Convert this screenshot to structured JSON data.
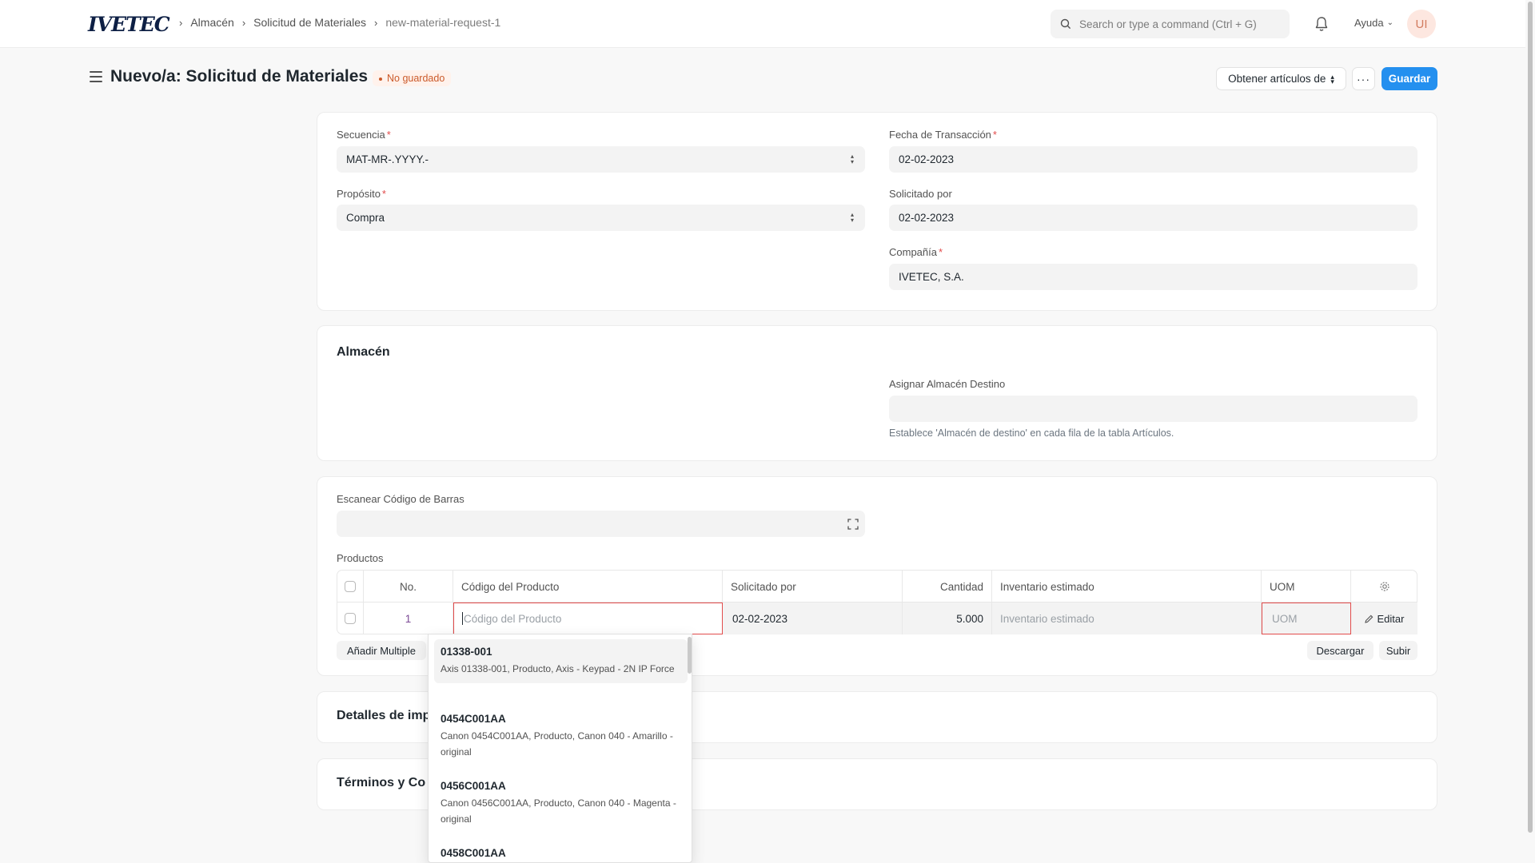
{
  "brand": {
    "logo_text": "IVETEC"
  },
  "breadcrumb": [
    "Almacén",
    "Solicitud de Materiales",
    "new-material-request-1"
  ],
  "search": {
    "placeholder": "Search or type a command (Ctrl + G)"
  },
  "navbar": {
    "help_label": "Ayuda",
    "avatar_initials": "UI"
  },
  "page": {
    "title": "Nuevo/a: Solicitud de Materiales",
    "status": "No guardado",
    "get_items_label": "Obtener artículos de",
    "more_label": "···",
    "save_label": "Guardar"
  },
  "form": {
    "secuencia": {
      "label": "Secuencia",
      "value": "MAT-MR-.YYYY.-"
    },
    "proposito": {
      "label": "Propósito",
      "value": "Compra"
    },
    "fecha": {
      "label": "Fecha de Transacción",
      "value": "02-02-2023"
    },
    "solicitado": {
      "label": "Solicitado por",
      "value": "02-02-2023"
    },
    "compania": {
      "label": "Compañía",
      "value": "IVETEC, S.A."
    }
  },
  "almacen": {
    "title": "Almacén",
    "destino_label": "Asignar Almacén Destino",
    "destino_value": "",
    "help": "Establece 'Almacén de destino' en cada fila de la tabla Artículos."
  },
  "productos": {
    "barcode_label": "Escanear Código de Barras",
    "table_label": "Productos",
    "columns": [
      "No.",
      "Código del Producto",
      "Solicitado por",
      "Cantidad",
      "Inventario estimado",
      "UOM"
    ],
    "row": {
      "no": "1",
      "codigo_placeholder": "Código del Producto",
      "solicitado": "02-02-2023",
      "cantidad": "5.000",
      "inventario_placeholder": "Inventario estimado",
      "uom_placeholder": "UOM",
      "edit_label": "Editar"
    },
    "add_multiple": "Añadir Multiple",
    "download": "Descargar",
    "upload": "Subir"
  },
  "dropdown": [
    {
      "code": "01338-001",
      "desc": "Axis 01338-001, Producto, Axis - Keypad - 2N IP Force"
    },
    {
      "code": "0454C001AA",
      "desc": "Canon 0454C001AA, Producto, Canon 040 - Amarillo - original"
    },
    {
      "code": "0456C001AA",
      "desc": "Canon 0456C001AA, Producto, Canon 040 - Magenta - original"
    },
    {
      "code": "0458C001AA",
      "desc": ""
    }
  ],
  "sections": {
    "detalles": "Detalles de imp",
    "terminos": "Términos y Co"
  },
  "colors": {
    "primary": "#2490ef",
    "danger": "#e24c4c",
    "unsaved_bg": "#fff2ec"
  }
}
